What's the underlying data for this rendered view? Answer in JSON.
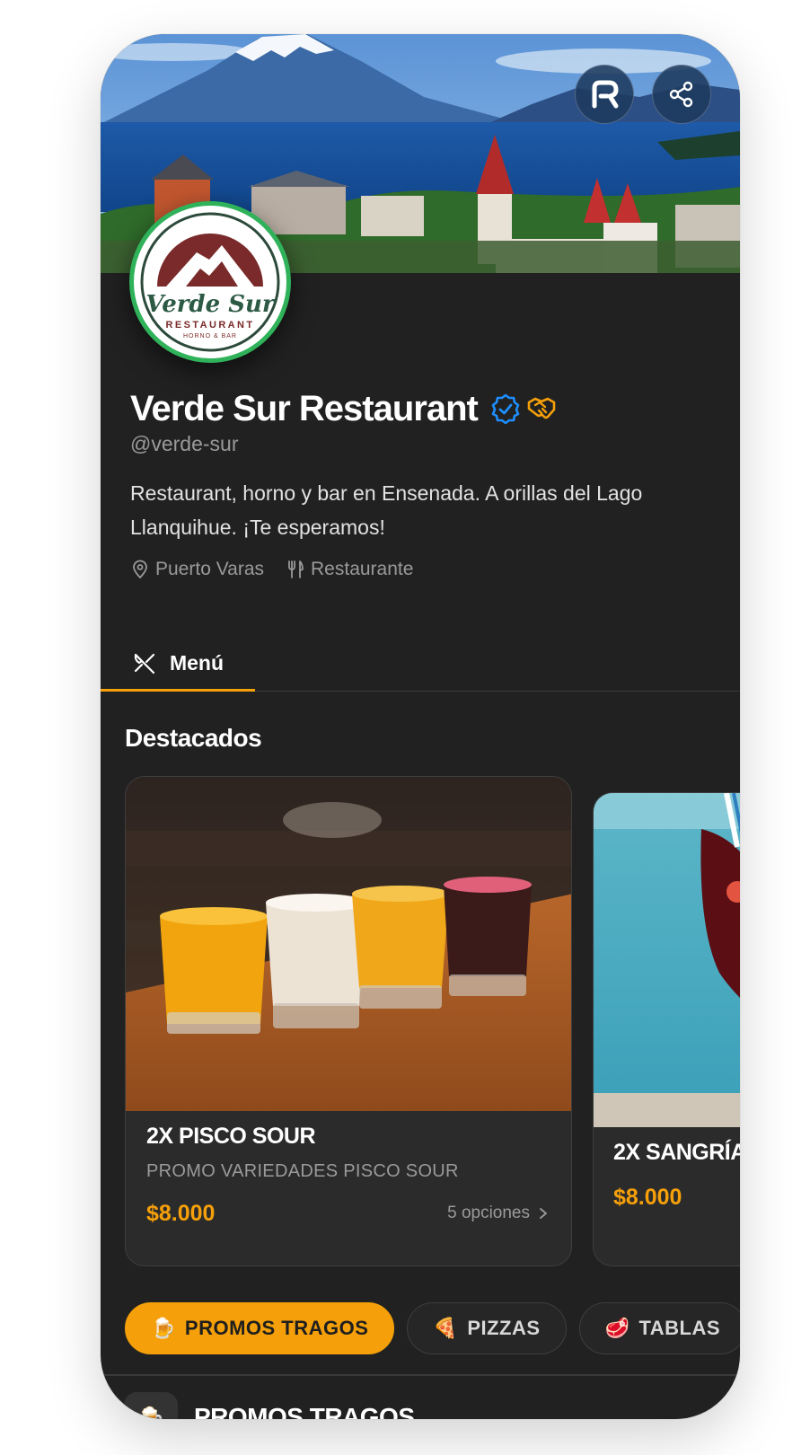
{
  "profile": {
    "name": "Verde Sur Restaurant",
    "handle": "@verde-sur",
    "bio": "Restaurant, horno y bar en Ensenada. A orillas del Lago Llanquihue. ¡Te esperamos!",
    "location": "Puerto Varas",
    "category": "Restaurante",
    "badges": [
      "verified-icon",
      "partner-handshake-icon"
    ]
  },
  "logo": {
    "title": "Verde Sur",
    "subtitle": "RESTAURANT",
    "tagline": "HORNO & BAR"
  },
  "tabs": [
    {
      "label": "Menú",
      "icon": "utensils-crossed-icon",
      "active": true
    }
  ],
  "featured": {
    "title": "Destacados",
    "items": [
      {
        "title": "2X PISCO SOUR",
        "subtitle": "PROMO VARIEDADES PISCO SOUR",
        "price": "$8.000",
        "options": "5 opciones"
      },
      {
        "title": "2X SANGRÍA",
        "price": "$8.000"
      }
    ]
  },
  "categories": [
    {
      "emoji": "🍺",
      "label": "PROMOS TRAGOS",
      "active": true
    },
    {
      "emoji": "🍕",
      "label": "PIZZAS",
      "active": false
    },
    {
      "emoji": "🥩",
      "label": "TABLAS",
      "active": false
    }
  ],
  "section": {
    "emoji": "🍺",
    "title": "PROMOS TRAGOS"
  },
  "colors": {
    "accent": "#f5a00a",
    "background": "#212121",
    "card": "#2b2b2b",
    "verified": "#1e8fff",
    "logo_ring": "#2fb25a"
  }
}
